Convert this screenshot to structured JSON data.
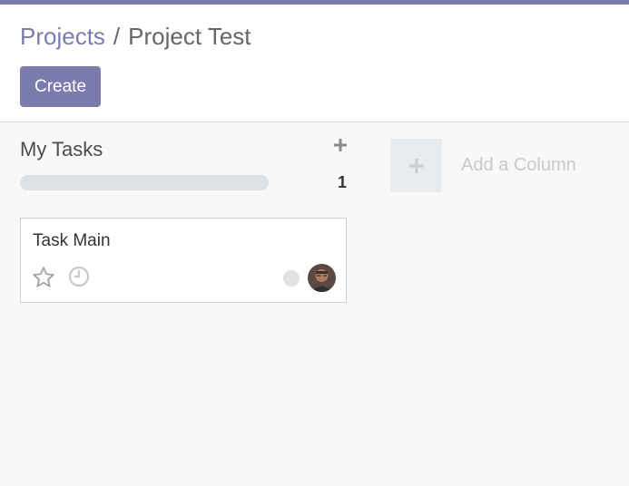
{
  "theme": {
    "accent": "#7c7bad"
  },
  "breadcrumb": {
    "parent": "Projects",
    "separator": "/",
    "current": "Project Test"
  },
  "control_panel": {
    "create_label": "Create"
  },
  "columns": [
    {
      "title": "My Tasks",
      "count": "1",
      "progress": 0,
      "add_icon": "plus-icon",
      "cards": [
        {
          "title": "Task Main",
          "star_icon": "star-outline-icon",
          "clock_icon": "clock-icon",
          "status": "normal",
          "assignee_avatar": "avatar"
        }
      ]
    }
  ],
  "add_column": {
    "label": "Add a Column",
    "icon": "plus-icon"
  }
}
